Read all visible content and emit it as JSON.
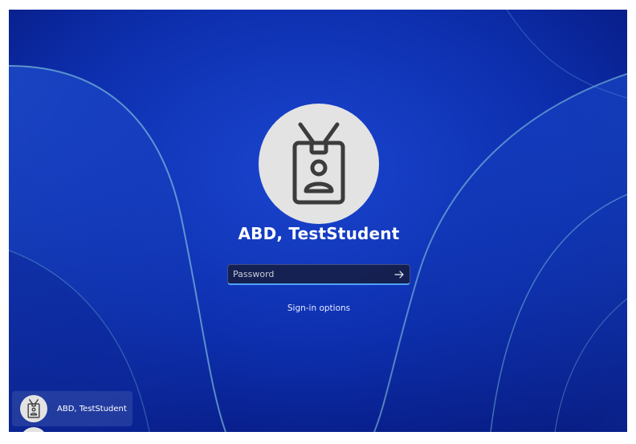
{
  "login": {
    "user_name": "ABD, TestStudent",
    "password_placeholder": "Password",
    "submit_icon": "arrow-right-icon",
    "signin_options_label": "Sign-in options"
  },
  "user_switcher": {
    "users": [
      {
        "name": "ABD, TestStudent",
        "icon": "id-badge-icon"
      }
    ]
  },
  "colors": {
    "wallpaper_base": "#0b2aa6",
    "avatar_bg": "#e3e3e3",
    "icon_stroke": "#3c3c3c",
    "focus_accent": "#4fa3f7"
  }
}
